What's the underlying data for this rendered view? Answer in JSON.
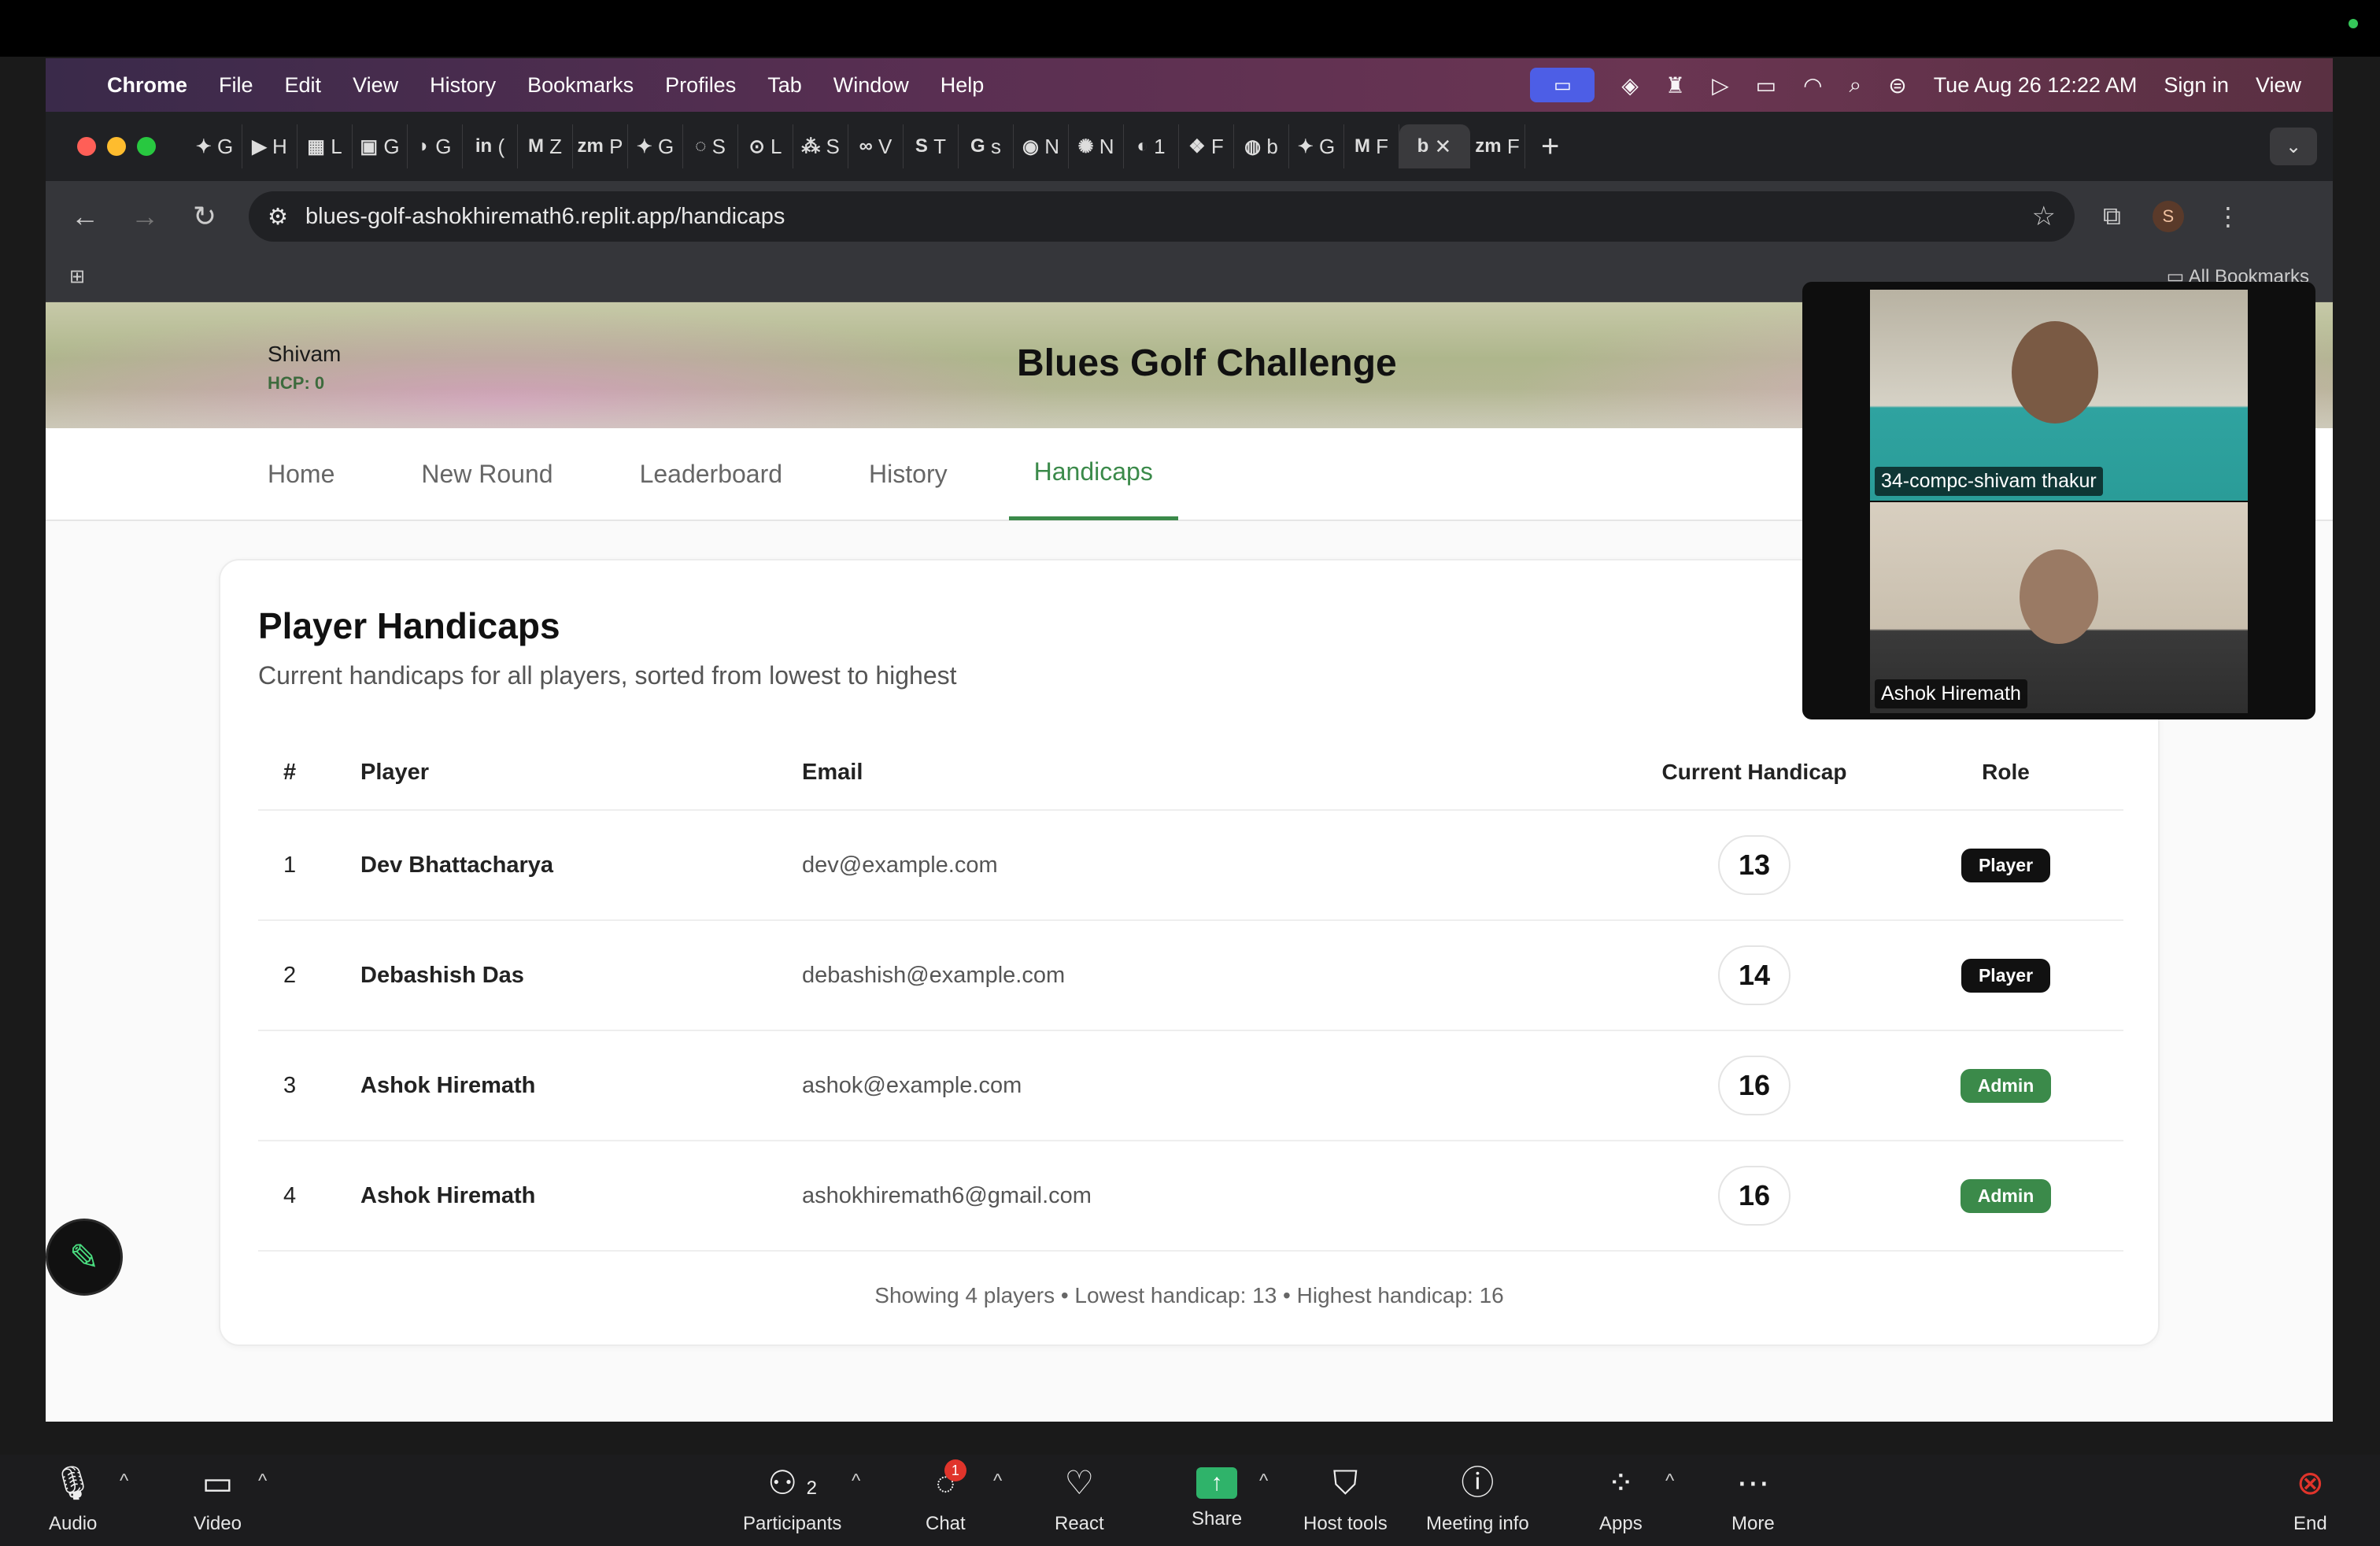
{
  "menubar": {
    "app": "Chrome",
    "items": [
      "File",
      "Edit",
      "View",
      "History",
      "Bookmarks",
      "Profiles",
      "Tab",
      "Window",
      "Help"
    ],
    "clock": "Tue Aug 26 12:22 AM",
    "signin": "Sign in",
    "view": "View"
  },
  "tabs": [
    {
      "glyph": "✦",
      "letter": "G"
    },
    {
      "glyph": "▶",
      "letter": "H"
    },
    {
      "glyph": "▦",
      "letter": "L"
    },
    {
      "glyph": "▣",
      "letter": "G"
    },
    {
      "glyph": "◗",
      "letter": "G"
    },
    {
      "glyph": "in",
      "letter": "("
    },
    {
      "glyph": "M",
      "letter": "Z"
    },
    {
      "glyph": "zm",
      "letter": "P"
    },
    {
      "glyph": "✦",
      "letter": "G"
    },
    {
      "glyph": "◌",
      "letter": "S"
    },
    {
      "glyph": "⊙",
      "letter": "L"
    },
    {
      "glyph": "⁂",
      "letter": "S"
    },
    {
      "glyph": "∞",
      "letter": "V"
    },
    {
      "glyph": "S",
      "letter": "T"
    },
    {
      "glyph": "G",
      "letter": "s"
    },
    {
      "glyph": "◉",
      "letter": "N"
    },
    {
      "glyph": "✺",
      "letter": "N"
    },
    {
      "glyph": "◐",
      "letter": "1"
    },
    {
      "glyph": "❖",
      "letter": "F"
    },
    {
      "glyph": "◍",
      "letter": "b"
    },
    {
      "glyph": "✦",
      "letter": "G"
    },
    {
      "glyph": "M",
      "letter": "F"
    },
    {
      "glyph": "b",
      "letter": "✕"
    },
    {
      "glyph": "zm",
      "letter": "F"
    }
  ],
  "address": "blues-golf-ashokhiremath6.replit.app/handicaps",
  "bookmarks_label": "All Bookmarks",
  "profile_initial": "S",
  "header": {
    "user_name": "Shivam",
    "user_hcp": "HCP: 0",
    "title": "Blues Golf Challenge"
  },
  "nav": [
    "Home",
    "New Round",
    "Leaderboard",
    "History",
    "Handicaps"
  ],
  "card": {
    "title": "Player Handicaps",
    "subtitle": "Current handicaps for all players, sorted from lowest to highest",
    "columns": [
      "#",
      "Player",
      "Email",
      "Current Handicap",
      "Role"
    ],
    "rows": [
      {
        "num": "1",
        "player": "Dev Bhattacharya",
        "email": "dev@example.com",
        "handicap": "13",
        "role": "Player"
      },
      {
        "num": "2",
        "player": "Debashish Das",
        "email": "debashish@example.com",
        "handicap": "14",
        "role": "Player"
      },
      {
        "num": "3",
        "player": "Ashok Hiremath",
        "email": "ashok@example.com",
        "handicap": "16",
        "role": "Admin"
      },
      {
        "num": "4",
        "player": "Ashok Hiremath",
        "email": "ashokhiremath6@gmail.com",
        "handicap": "16",
        "role": "Admin"
      }
    ],
    "footer": "Showing 4 players • Lowest handicap: 13 • Highest handicap: 16"
  },
  "role_colors": {
    "Player": "#111111",
    "Admin": "#3b8a4a"
  },
  "video": {
    "p1": "34-compc-shivam thakur",
    "p2": "Ashok Hiremath"
  },
  "zoom": {
    "audio": "Audio",
    "video": "Video",
    "participants": "Participants",
    "participants_count": "2",
    "chat": "Chat",
    "chat_badge": "1",
    "react": "React",
    "share": "Share",
    "host_tools": "Host tools",
    "meeting_info": "Meeting info",
    "apps": "Apps",
    "more": "More",
    "end": "End"
  }
}
